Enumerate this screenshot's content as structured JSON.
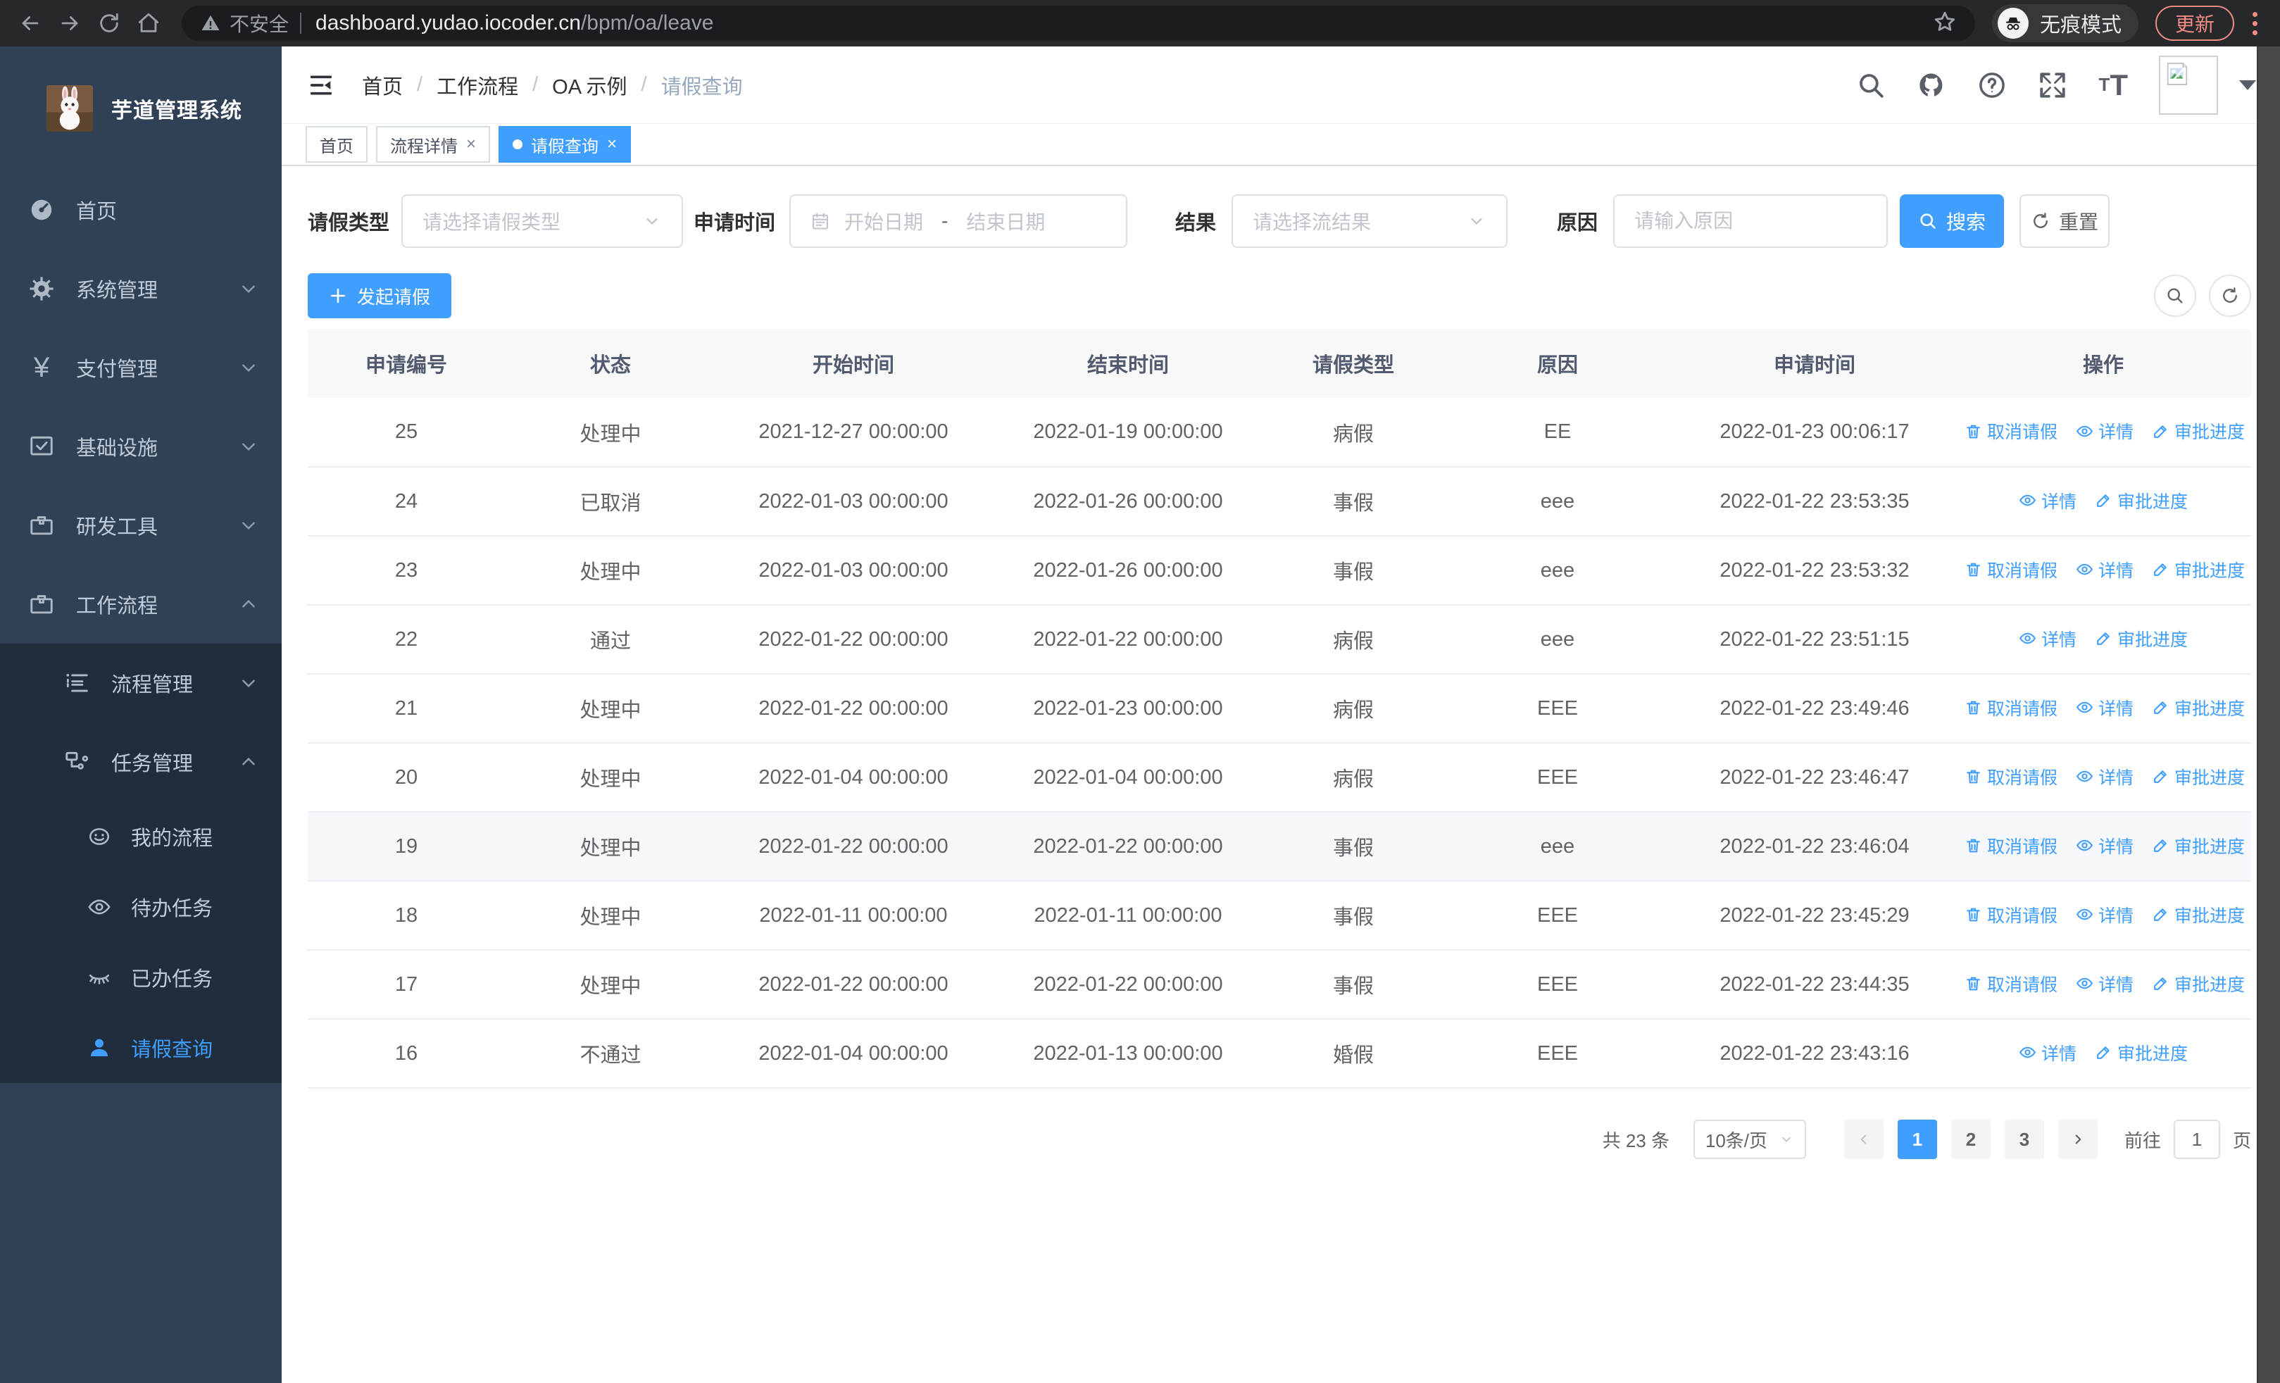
{
  "ui": {
    "crumb_sep": "/",
    "close_glyph": "×",
    "currency_glyph": "¥"
  },
  "browser": {
    "security_label": "不安全",
    "url_host": "dashboard.yudao.iocoder.cn",
    "url_path": "/bpm/oa/leave",
    "incognito_label": "无痕模式",
    "update_label": "更新"
  },
  "sidebar": {
    "title": "芋道管理系统",
    "items": [
      {
        "label": "首页"
      },
      {
        "label": "系统管理"
      },
      {
        "label": "支付管理"
      },
      {
        "label": "基础设施"
      },
      {
        "label": "研发工具"
      },
      {
        "label": "工作流程"
      }
    ],
    "submenu": [
      {
        "label": "流程管理"
      },
      {
        "label": "任务管理"
      }
    ],
    "task_items": [
      {
        "label": "我的流程"
      },
      {
        "label": "待办任务"
      },
      {
        "label": "已办任务"
      },
      {
        "label": "请假查询"
      }
    ]
  },
  "breadcrumb": [
    "首页",
    "工作流程",
    "OA 示例",
    "请假查询"
  ],
  "tabs": [
    {
      "label": "首页"
    },
    {
      "label": "流程详情"
    },
    {
      "label": "请假查询"
    }
  ],
  "filters": {
    "leave_type_label": "请假类型",
    "leave_type_placeholder": "请选择请假类型",
    "apply_time_label": "申请时间",
    "start_placeholder": "开始日期",
    "range_separator": "-",
    "end_placeholder": "结束日期",
    "result_label": "结果",
    "result_placeholder": "请选择流结果",
    "reason_label": "原因",
    "reason_placeholder": "请输入原因",
    "search_label": "搜索",
    "reset_label": "重置"
  },
  "toolbar": {
    "create_label": "发起请假"
  },
  "table": {
    "columns": [
      "申请编号",
      "状态",
      "开始时间",
      "结束时间",
      "请假类型",
      "原因",
      "申请时间",
      "操作"
    ],
    "action_labels": {
      "cancel": "取消请假",
      "detail": "详情",
      "progress": "审批进度"
    },
    "rows": [
      {
        "id": "25",
        "status": "处理中",
        "start": "2021-12-27 00:00:00",
        "end": "2022-01-19 00:00:00",
        "type": "病假",
        "reason": "EE",
        "apply_time": "2022-01-23 00:06:17",
        "actions": [
          "cancel",
          "detail",
          "progress"
        ],
        "highlight": false
      },
      {
        "id": "24",
        "status": "已取消",
        "start": "2022-01-03 00:00:00",
        "end": "2022-01-26 00:00:00",
        "type": "事假",
        "reason": "eee",
        "apply_time": "2022-01-22 23:53:35",
        "actions": [
          "detail",
          "progress"
        ],
        "highlight": false
      },
      {
        "id": "23",
        "status": "处理中",
        "start": "2022-01-03 00:00:00",
        "end": "2022-01-26 00:00:00",
        "type": "事假",
        "reason": "eee",
        "apply_time": "2022-01-22 23:53:32",
        "actions": [
          "cancel",
          "detail",
          "progress"
        ],
        "highlight": false
      },
      {
        "id": "22",
        "status": "通过",
        "start": "2022-01-22 00:00:00",
        "end": "2022-01-22 00:00:00",
        "type": "病假",
        "reason": "eee",
        "apply_time": "2022-01-22 23:51:15",
        "actions": [
          "detail",
          "progress"
        ],
        "highlight": false
      },
      {
        "id": "21",
        "status": "处理中",
        "start": "2022-01-22 00:00:00",
        "end": "2022-01-23 00:00:00",
        "type": "病假",
        "reason": "EEE",
        "apply_time": "2022-01-22 23:49:46",
        "actions": [
          "cancel",
          "detail",
          "progress"
        ],
        "highlight": false
      },
      {
        "id": "20",
        "status": "处理中",
        "start": "2022-01-04 00:00:00",
        "end": "2022-01-04 00:00:00",
        "type": "病假",
        "reason": "EEE",
        "apply_time": "2022-01-22 23:46:47",
        "actions": [
          "cancel",
          "detail",
          "progress"
        ],
        "highlight": false
      },
      {
        "id": "19",
        "status": "处理中",
        "start": "2022-01-22 00:00:00",
        "end": "2022-01-22 00:00:00",
        "type": "事假",
        "reason": "eee",
        "apply_time": "2022-01-22 23:46:04",
        "actions": [
          "cancel",
          "detail",
          "progress"
        ],
        "highlight": true
      },
      {
        "id": "18",
        "status": "处理中",
        "start": "2022-01-11 00:00:00",
        "end": "2022-01-11 00:00:00",
        "type": "事假",
        "reason": "EEE",
        "apply_time": "2022-01-22 23:45:29",
        "actions": [
          "cancel",
          "detail",
          "progress"
        ],
        "highlight": false
      },
      {
        "id": "17",
        "status": "处理中",
        "start": "2022-01-22 00:00:00",
        "end": "2022-01-22 00:00:00",
        "type": "事假",
        "reason": "EEE",
        "apply_time": "2022-01-22 23:44:35",
        "actions": [
          "cancel",
          "detail",
          "progress"
        ],
        "highlight": false
      },
      {
        "id": "16",
        "status": "不通过",
        "start": "2022-01-04 00:00:00",
        "end": "2022-01-13 00:00:00",
        "type": "婚假",
        "reason": "EEE",
        "apply_time": "2022-01-22 23:43:16",
        "actions": [
          "detail",
          "progress"
        ],
        "highlight": false
      }
    ]
  },
  "pagination": {
    "total_label": "共 23 条",
    "page_size": "10条/页",
    "pages": [
      "1",
      "2",
      "3"
    ],
    "active_page": "1",
    "goto_label": "前往",
    "goto_value": "1",
    "page_unit": "页"
  }
}
